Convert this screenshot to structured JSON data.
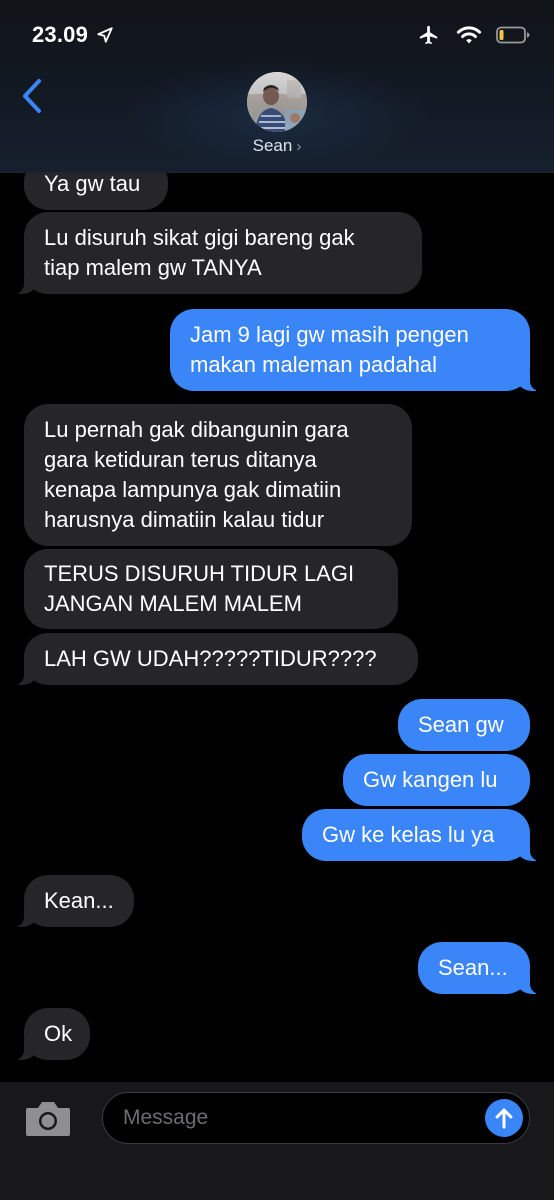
{
  "status_bar": {
    "time": "23.09"
  },
  "header": {
    "contact_name": "Sean",
    "chevron": "›"
  },
  "messages": [
    {
      "dir": "in",
      "lines": [
        "Ya gw tau"
      ]
    },
    {
      "dir": "in",
      "lines": [
        "Lu disuruh sikat gigi bareng gak",
        "tiap malem gw TANYA"
      ]
    },
    {
      "dir": "out",
      "lines": [
        "Jam 9 lagi gw masih pengen",
        "makan maleman padahal"
      ]
    },
    {
      "dir": "in",
      "lines": [
        "Lu pernah gak dibangunin gara",
        "gara ketiduran terus ditanya",
        "kenapa lampunya gak dimatiin",
        "harusnya dimatiin kalau tidur"
      ]
    },
    {
      "dir": "in",
      "lines": [
        "TERUS DISURUH TIDUR LAGI",
        "JANGAN MALEM MALEM"
      ]
    },
    {
      "dir": "in",
      "lines": [
        "LAH GW UDAH?????TIDUR????"
      ]
    },
    {
      "dir": "out",
      "lines": [
        "Sean gw"
      ]
    },
    {
      "dir": "out",
      "lines": [
        "Gw kangen lu"
      ]
    },
    {
      "dir": "out",
      "lines": [
        "Gw ke kelas lu ya"
      ]
    },
    {
      "dir": "in",
      "lines": [
        "Kean..."
      ]
    },
    {
      "dir": "out",
      "lines": [
        "Sean..."
      ]
    },
    {
      "dir": "in",
      "lines": [
        "Ok"
      ]
    }
  ],
  "input": {
    "placeholder": "Message"
  },
  "colors": {
    "incoming": "#262629",
    "outgoing": "#3a85f7",
    "accent": "#3a85f7"
  },
  "icons": [
    "location-arrow-icon",
    "airplane-icon",
    "wifi-icon",
    "battery-icon",
    "back-chevron-icon",
    "camera-icon",
    "send-arrow-icon"
  ]
}
